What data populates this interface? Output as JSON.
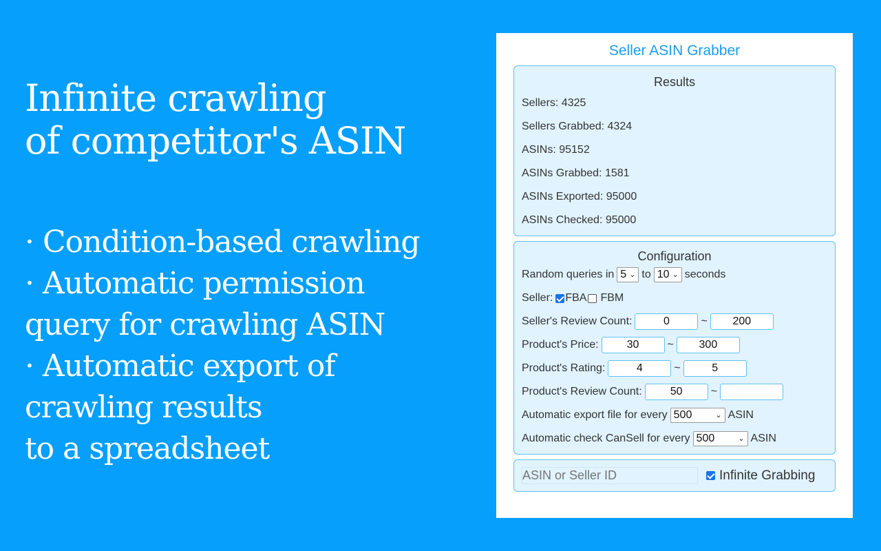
{
  "promo": {
    "headline_lines": [
      "Infinite crawling",
      "of competitor's ASIN"
    ],
    "bullet_glyph": "·",
    "features": [
      {
        "lines": [
          "Condition-based crawling"
        ]
      },
      {
        "lines": [
          "Automatic permission",
          "query for crawling ASIN"
        ]
      },
      {
        "lines": [
          "Automatic export of",
          "crawling results",
          "to a spreadsheet"
        ]
      }
    ]
  },
  "panel": {
    "title": "Seller ASIN Grabber",
    "results": {
      "title": "Results",
      "stats": [
        {
          "label": "Sellers: ",
          "value": "4325"
        },
        {
          "label": "Sellers Grabbed: ",
          "value": "4324"
        },
        {
          "label": "ASINs: ",
          "value": "95152"
        },
        {
          "label": "ASINs Grabbed: ",
          "value": "1581"
        },
        {
          "label": "ASINs Exported: ",
          "value": "95000"
        },
        {
          "label": "ASINs Checked: ",
          "value": "95000"
        }
      ]
    },
    "configuration": {
      "title": "Configuration",
      "random_queries": {
        "prefix": "Random queries in",
        "min": "5",
        "middle": "to",
        "max": "10",
        "suffix": "seconds"
      },
      "seller": {
        "label": "Seller:",
        "fba_label": "FBA",
        "fba_checked": true,
        "fbm_label": "FBM",
        "fbm_checked": false
      },
      "seller_review_count": {
        "label": "Seller's Review Count:",
        "min": "0",
        "sep": "~",
        "max": "200"
      },
      "product_price": {
        "label": "Product's Price:",
        "min": "30",
        "sep": "~",
        "max": "300"
      },
      "product_rating": {
        "label": "Product's Rating:",
        "min": "4",
        "sep": "~",
        "max": "5"
      },
      "product_review_count": {
        "label": "Product's Review Count:",
        "min": "50",
        "sep": "~",
        "max": ""
      },
      "auto_export": {
        "label": "Automatic export file for every",
        "value": "500",
        "suffix": "ASIN"
      },
      "auto_cansell": {
        "label": "Automatic check CanSell for every",
        "value": "500",
        "suffix": "ASIN"
      }
    },
    "grab": {
      "input_value": "",
      "input_placeholder": "ASIN or Seller ID",
      "infinite_label": "Infinite Grabbing",
      "infinite_checked": true
    },
    "colors": {
      "background": "#069ffc",
      "accent": "#1a9cf0",
      "box_bg": "#e1f3fe",
      "box_border": "#5ec1f5"
    }
  }
}
